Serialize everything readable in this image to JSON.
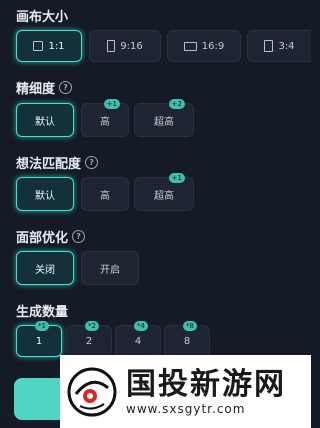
{
  "canvas_size": {
    "title": "画布大小",
    "options": [
      {
        "label": "1:1",
        "icon": "square-ratio-icon",
        "active": true
      },
      {
        "label": "9:16",
        "icon": "portrait-ratio-icon",
        "active": false
      },
      {
        "label": "16:9",
        "icon": "landscape-ratio-icon",
        "active": false
      },
      {
        "label": "3:4",
        "icon": "portrait-ratio-icon",
        "active": false
      }
    ]
  },
  "detail": {
    "title": "精细度",
    "options": [
      {
        "label": "默认",
        "active": true,
        "badge": ""
      },
      {
        "label": "高",
        "active": false,
        "badge": "+1"
      },
      {
        "label": "超高",
        "active": false,
        "badge": "+2"
      }
    ]
  },
  "match": {
    "title": "想法匹配度",
    "options": [
      {
        "label": "默认",
        "active": true,
        "badge": ""
      },
      {
        "label": "高",
        "active": false,
        "badge": ""
      },
      {
        "label": "超高",
        "active": false,
        "badge": "+1"
      }
    ]
  },
  "face": {
    "title": "面部优化",
    "options": [
      {
        "label": "关闭",
        "active": true
      },
      {
        "label": "开启",
        "active": false
      }
    ]
  },
  "count": {
    "title": "生成数量",
    "options": [
      {
        "label": "1",
        "active": true,
        "badge": "*1"
      },
      {
        "label": "2",
        "active": false,
        "badge": "*2"
      },
      {
        "label": "4",
        "active": false,
        "badge": "*4"
      },
      {
        "label": "8",
        "active": false,
        "badge": "*8"
      }
    ]
  },
  "watermark": {
    "title": "国投新游网",
    "url": "www.sxsgytr.com"
  },
  "colors": {
    "accent": "#3ce6cf",
    "background": "#141a26"
  }
}
